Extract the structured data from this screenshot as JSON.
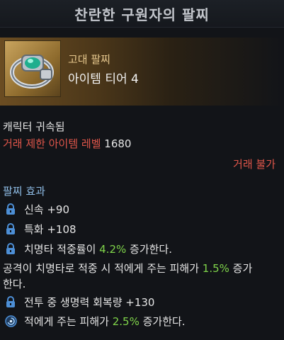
{
  "title": "찬란한 구원자의 팔찌",
  "item": {
    "grade": "고대 팔찌",
    "tier": "아이템 티어 4",
    "icon": "bracelet-icon"
  },
  "bound": "캐릭터 귀속됨",
  "trade_level": {
    "label": "거래 제한 아이템 레벨",
    "value": "1680"
  },
  "no_trade": "거래 불가",
  "effects_title": "팔찌 효과",
  "effects": {
    "e1": "신속 +90",
    "e2": "특화 +108",
    "e3_pre": "치명타 적중률이 ",
    "e3_val": "4.2%",
    "e3_post": " 증가한다.",
    "e4_pre": "공격이 치명타로 적중 시 적에게 주는 피해가 ",
    "e4_val": "1.5%",
    "e4_post": " 증가",
    "e4_line2": "한다.",
    "e5": "전투 중 생명력 회복량 +130",
    "e6_pre": "적에게 주는 피해가 ",
    "e6_val": "2.5%",
    "e6_post": " 증가한다."
  },
  "colors": {
    "grade": "#e8c98f",
    "warning": "#e0564a",
    "section": "#8fbde6",
    "highlight": "#7fd44a",
    "lock": "#4d8fd6"
  },
  "icons": {
    "lock": "lock-icon",
    "swirl": "swirl-icon"
  }
}
